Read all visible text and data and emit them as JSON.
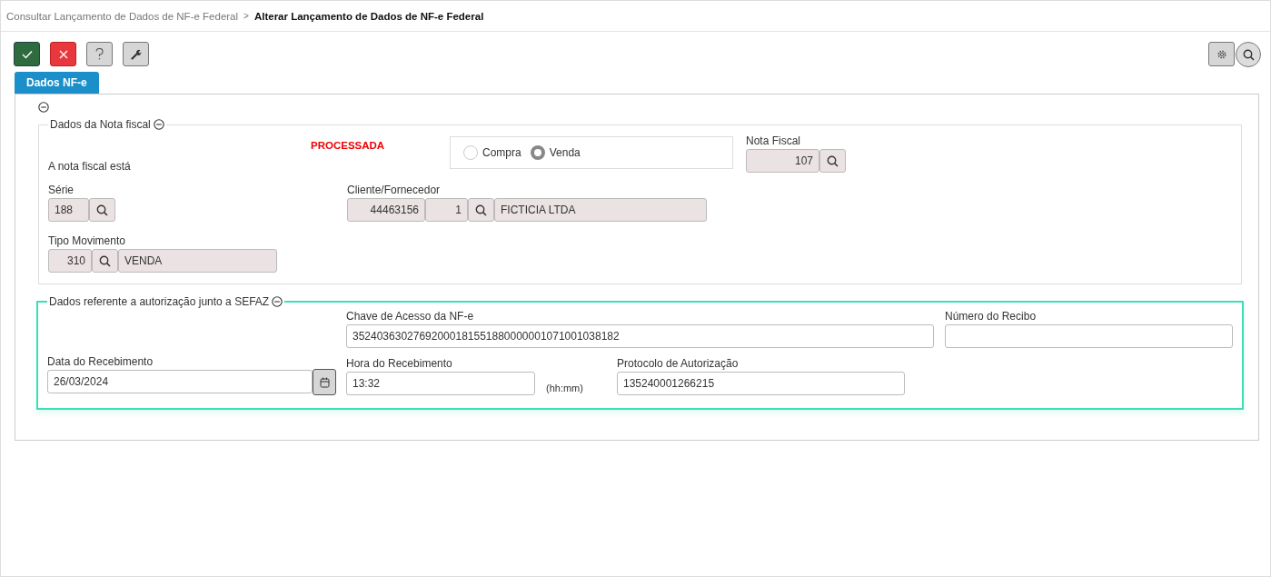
{
  "breadcrumb": [
    {
      "label": "Consultar Lançamento de Dados de NF-e Federal",
      "current": false,
      "separator": ">"
    },
    {
      "label": "Alterar Lançamento de Dados de NF-e Federal",
      "current": true
    }
  ],
  "tabs": [
    {
      "label": "Dados NF-e",
      "selected": true
    }
  ],
  "nota_fiscal_section": {
    "title": "Dados da Nota fiscal",
    "status_label": "A nota fiscal está",
    "status": "PROCESSADA",
    "operation": [
      {
        "label": "Compra",
        "selected": false
      },
      {
        "label": "Venda",
        "selected": true
      }
    ],
    "nota_fiscal": {
      "label": "Nota Fiscal",
      "value": "107"
    },
    "serie": {
      "label": "Série",
      "value": "188"
    },
    "cliente": {
      "label": "Cliente/Fornecedor",
      "code": "44463156",
      "branch": "1",
      "name": "FICTICIA LTDA"
    },
    "tipo_movimento": {
      "label": "Tipo Movimento",
      "code": "310",
      "name": "VENDA"
    }
  },
  "sefaz_section": {
    "title": "Dados referente a autorização junto a SEFAZ",
    "chave": {
      "label": "Chave de Acesso da NF-e",
      "value": "35240363027692000181551880000001071001038182"
    },
    "recibo": {
      "label": "Número do Recibo"
    },
    "data": {
      "label": "Data do Recebimento",
      "value": "26/03/2024"
    },
    "hora": {
      "label": "Hora do Recebimento",
      "value": "13:32",
      "hint": "(hh:mm)"
    },
    "protocolo": {
      "label": "Protocolo de Autorização",
      "value": "135240001266215"
    }
  }
}
